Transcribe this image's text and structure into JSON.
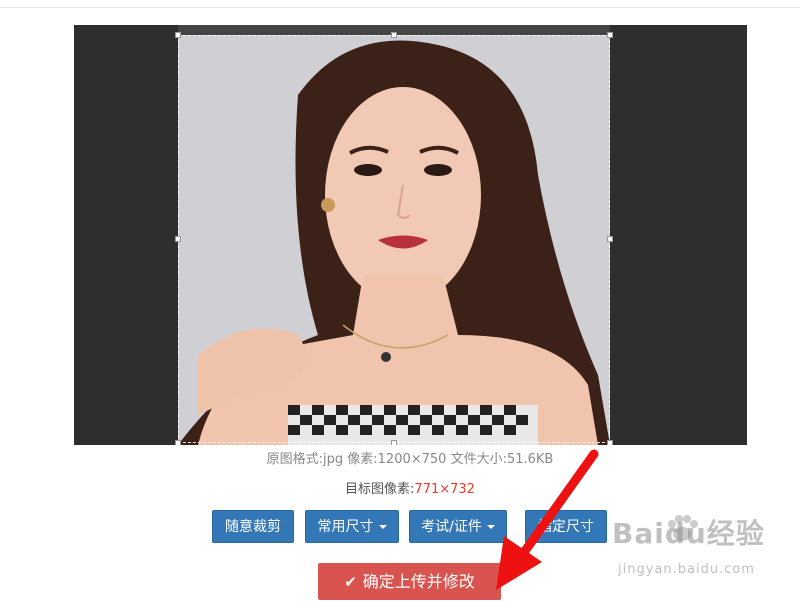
{
  "image_info": {
    "prefix": "原图格式:jpg  像素:1200×750  文件大小:51.6KB"
  },
  "target": {
    "label": "目标图像素:",
    "value": "771×732"
  },
  "buttons": {
    "free_crop": "随意裁剪",
    "common_size": "常用尺寸",
    "exam_id": "考试/证件",
    "custom_size": "指定尺寸"
  },
  "confirm": {
    "label": "确定上传并修改"
  },
  "watermark": {
    "logo": "Baidu经验",
    "url": "jingyan.baidu.com"
  },
  "colors": {
    "primary_button": "#3377b7",
    "confirm_button": "#d9534f",
    "highlight_text": "#e63a2e",
    "arrow": "#ee1111"
  }
}
